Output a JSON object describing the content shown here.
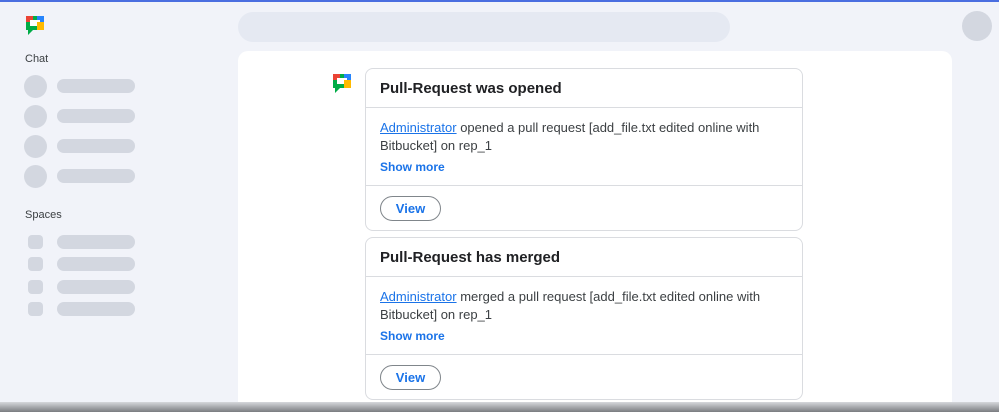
{
  "sidebar": {
    "chat_label": "Chat",
    "spaces_label": "Spaces",
    "chat_placeholders": 4,
    "space_placeholders": 4
  },
  "messages": [
    {
      "title": "Pull-Request was opened",
      "author": "Administrator",
      "text": "opened a pull request [add_file.txt edited online with Bitbucket] on rep_1",
      "show_more": "Show more",
      "button": "View"
    },
    {
      "title": "Pull-Request has merged",
      "author": "Administrator",
      "text": "merged a pull request [add_file.txt edited online with Bitbucket] on rep_1",
      "show_more": "Show more",
      "button": "View"
    }
  ],
  "icons": {
    "app_logo": "google-chat-icon",
    "bot_avatar": "google-chat-icon"
  },
  "colors": {
    "accent": "#1a73e8",
    "logo_green": "#00ac47",
    "logo_yellow": "#ffba00",
    "logo_blue": "#2684fc",
    "placeholder": "#d3d7e0"
  }
}
